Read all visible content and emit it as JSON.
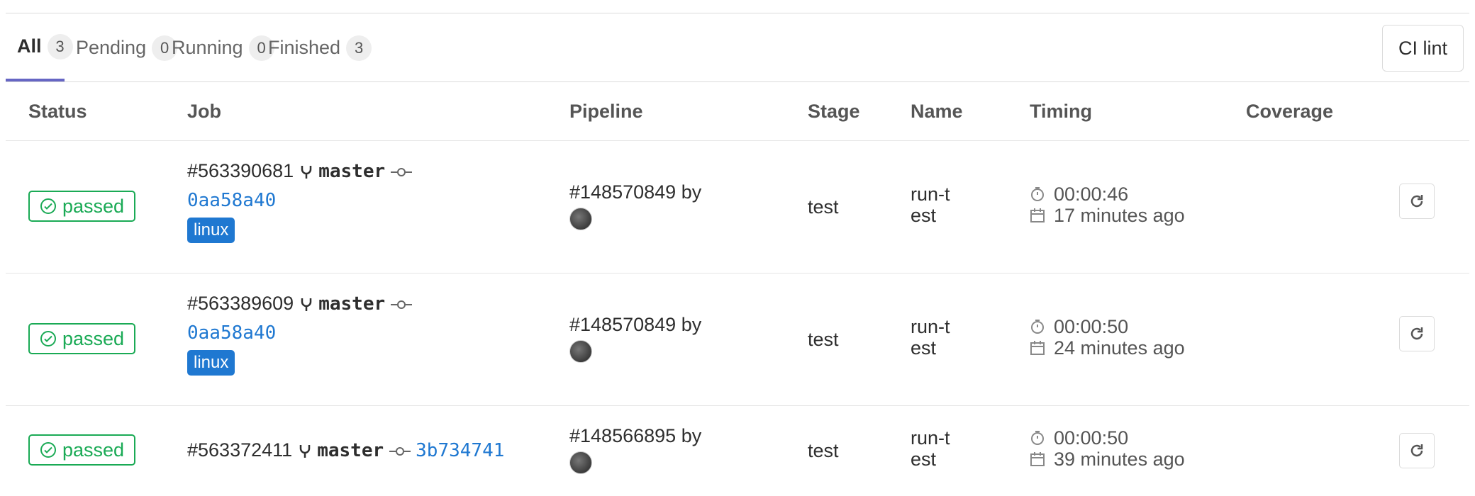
{
  "tabs": [
    {
      "label": "All",
      "count": "3"
    },
    {
      "label": "Pending",
      "count": "0"
    },
    {
      "label": "Running",
      "count": "0"
    },
    {
      "label": "Finished",
      "count": "3"
    }
  ],
  "ci_lint_label": "CI lint",
  "columns": {
    "status": "Status",
    "job": "Job",
    "pipeline": "Pipeline",
    "stage": "Stage",
    "name": "Name",
    "timing": "Timing",
    "coverage": "Coverage"
  },
  "jobs": [
    {
      "status": "passed",
      "id": "#563390681",
      "ref": "master",
      "sha": "0aa58a40",
      "tag": "linux",
      "pipeline": "#148570849",
      "pipeline_by": "by",
      "stage": "test",
      "name": "run-test",
      "duration": "00:00:46",
      "finished": "17 minutes ago"
    },
    {
      "status": "passed",
      "id": "#563389609",
      "ref": "master",
      "sha": "0aa58a40",
      "tag": "linux",
      "pipeline": "#148570849",
      "pipeline_by": "by",
      "stage": "test",
      "name": "run-test",
      "duration": "00:00:50",
      "finished": "24 minutes ago"
    },
    {
      "status": "passed",
      "id": "#563372411",
      "ref": "master",
      "sha": "3b734741",
      "tag": "",
      "pipeline": "#148566895",
      "pipeline_by": "by",
      "stage": "test",
      "name": "run-test",
      "duration": "00:00:50",
      "finished": "39 minutes ago"
    }
  ],
  "colors": {
    "success": "#1aaa55",
    "link": "#1f78d1",
    "active_tab_underline": "#6666c4"
  },
  "icons": {
    "status": "check-circle-icon",
    "branch": "fork-icon",
    "commit": "commit-icon",
    "duration": "stopwatch-icon",
    "date": "calendar-icon",
    "retry": "retry-icon"
  }
}
